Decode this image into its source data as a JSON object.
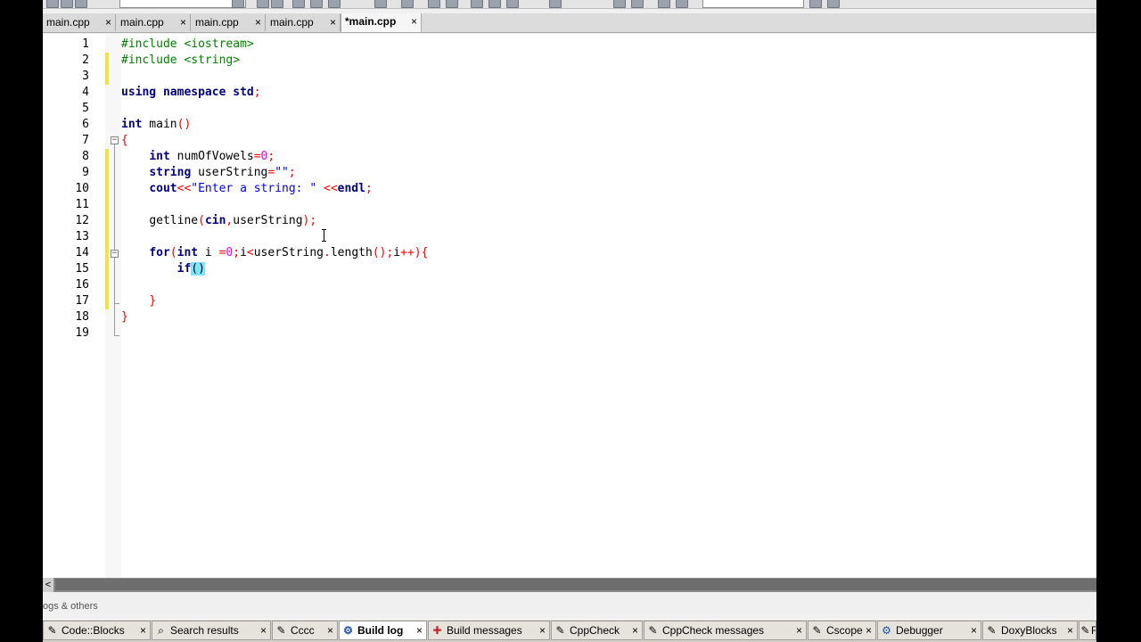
{
  "tabs": [
    {
      "label": "main.cpp"
    },
    {
      "label": "main.cpp"
    },
    {
      "label": "main.cpp"
    },
    {
      "label": "main.cpp"
    },
    {
      "label": "*main.cpp"
    }
  ],
  "tab_close_glyph": "×",
  "line_numbers": [
    "1",
    "2",
    "3",
    "4",
    "5",
    "6",
    "7",
    "8",
    "9",
    "10",
    "11",
    "12",
    "13",
    "14",
    "15",
    "16",
    "17",
    "18",
    "19"
  ],
  "code": {
    "l1": {
      "pp": "#include <iostream>"
    },
    "l2": {
      "pp": "#include <string>"
    },
    "l4": {
      "kw1": "using",
      "kw2": "namespace",
      "kw3": "std",
      "semi": ";"
    },
    "l6": {
      "kw": "int",
      "rest": " main",
      "paren": "()"
    },
    "l7": {
      "brace": "{"
    },
    "l8": {
      "kw": "int",
      "name": " numOfVowels",
      "op": "=",
      "num": "0",
      "semi": ";"
    },
    "l9": {
      "kw": "string",
      "name": " userString",
      "op": "=",
      "str": "\"\"",
      "semi": ";"
    },
    "l10": {
      "kw": "cout",
      "op1": "<<",
      "str": "\"Enter a string: \"",
      "sp": " ",
      "op2": "<<",
      "kw2": "endl",
      "semi": ";"
    },
    "l12": {
      "name": "getline",
      "p1": "(",
      "kw": "cin",
      "comma": ",",
      "arg": "userString",
      "p2": ")",
      "semi": ";"
    },
    "l14": {
      "kw": "for",
      "p1": "(",
      "kw2": "int",
      "a": " i ",
      "op": "=",
      "num": "0",
      "s1": ";",
      "b": "i",
      "op2": "<",
      "c": "userString",
      "d": ".",
      "e": "length",
      "p2": "()",
      "s2": ";",
      "f": "i",
      "op3": "++",
      "p3": ")",
      "brace": "{"
    },
    "l15": {
      "kw": "if",
      "open": "(",
      "close": ")"
    },
    "l17": {
      "brace": "}"
    },
    "l18": {
      "brace": "}"
    }
  },
  "panel_label": "ogs & others",
  "scroll_left_glyph": "<",
  "bottom_tabs": [
    {
      "label": "Code::Blocks",
      "icon": "code-blocks-icon",
      "glyph": "✎"
    },
    {
      "label": "Search results",
      "icon": "search-icon",
      "glyph": "⌕"
    },
    {
      "label": "Cccc",
      "icon": "cccc-icon",
      "glyph": "✎"
    },
    {
      "label": "Build log",
      "icon": "build-log-icon",
      "glyph": "⚙"
    },
    {
      "label": "Build messages",
      "icon": "build-messages-icon",
      "glyph": "✚"
    },
    {
      "label": "CppCheck",
      "icon": "cppcheck-icon",
      "glyph": "✎"
    },
    {
      "label": "CppCheck messages",
      "icon": "cppcheck-messages-icon",
      "glyph": "✎"
    },
    {
      "label": "Cscope",
      "icon": "cscope-icon",
      "glyph": "✎"
    },
    {
      "label": "Debugger",
      "icon": "debugger-icon",
      "glyph": "⚙"
    },
    {
      "label": "DoxyBlocks",
      "icon": "doxyblocks-icon",
      "glyph": "✎"
    },
    {
      "label": "F",
      "icon": "fortran-icon",
      "glyph": "✎"
    }
  ],
  "colors": {
    "keyword": "#000080",
    "preprocessor": "#008000",
    "string": "#0000ff",
    "number": "#f000f0",
    "operator": "#ff0000",
    "change_marker": "#f2e24a",
    "brace_highlight": "#7fe4ff"
  }
}
